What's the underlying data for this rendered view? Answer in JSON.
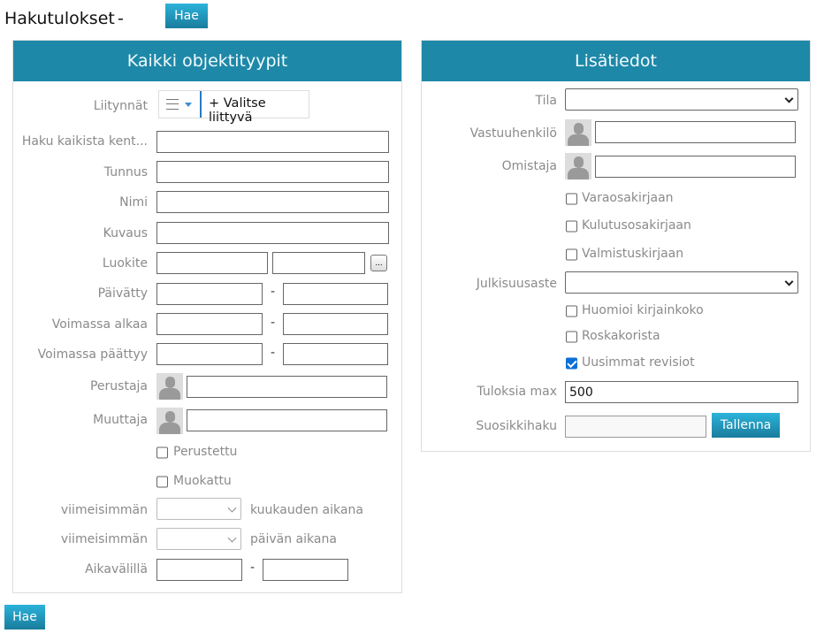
{
  "header": {
    "title": "Hakutulokset",
    "separator": "-",
    "search_button": "Hae"
  },
  "left_panel": {
    "title": "Kaikki objektityypit",
    "liitynnat_label": "Liitynnät",
    "select_related": "+ Valitse liittyvä",
    "labels": {
      "haku": "Haku kaikista kent...",
      "tunnus": "Tunnus",
      "nimi": "Nimi",
      "kuvaus": "Kuvaus",
      "luokite": "Luokite",
      "paivatty": "Päivätty",
      "voimassa_alkaa": "Voimassa alkaa",
      "voimassa_paattyy": "Voimassa päättyy",
      "perustaja": "Perustaja",
      "muuttaja": "Muuttaja",
      "viimeisimman1": "viimeisimmän",
      "viimeisimman2": "viimeisimmän",
      "aikavalilla": "Aikavälillä"
    },
    "luokite_button": "...",
    "dash": "-",
    "checkboxes": {
      "perustettu": "Perustettu",
      "muokattu": "Muokattu"
    },
    "months_suffix": "kuukauden aikana",
    "days_suffix": "päivän aikana"
  },
  "right_panel": {
    "title": "Lisätiedot",
    "labels": {
      "tila": "Tila",
      "vastuuhenkilo": "Vastuuhenkilö",
      "omistaja": "Omistaja",
      "julkisuusaste": "Julkisuusaste",
      "tuloksia_max": "Tuloksia max",
      "suosikkihaku": "Suosikkihaku"
    },
    "checkboxes": [
      {
        "label": "Varaosakirjaan",
        "checked": false
      },
      {
        "label": "Kulutusosakirjaan",
        "checked": false
      },
      {
        "label": "Valmistuskirjaan",
        "checked": false
      },
      {
        "label": "Huomioi kirjainkoko",
        "checked": false
      },
      {
        "label": "Roskakorista",
        "checked": false
      },
      {
        "label": "Uusimmat revisiot",
        "checked": true
      }
    ],
    "tuloksia_max_value": "500",
    "save_button": "Tallenna"
  },
  "footer": {
    "search_button": "Hae"
  }
}
